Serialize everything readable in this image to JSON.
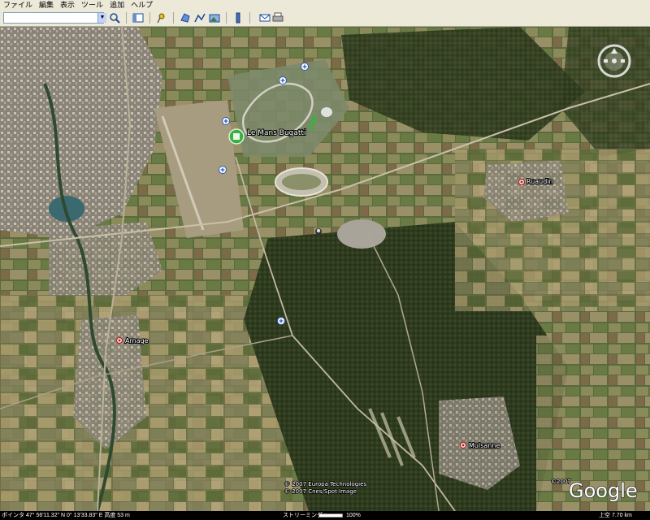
{
  "menu": [
    "ファイル",
    "編集",
    "表示",
    "ツール",
    "追加",
    "ヘルプ"
  ],
  "search": {
    "value": ""
  },
  "map": {
    "poi": {
      "label": "Le Mans Bugatti"
    },
    "places": [
      {
        "label": "Ruaudin"
      },
      {
        "label": "Arnage"
      },
      {
        "label": "Mulsanne"
      }
    ],
    "copyright": [
      "© 2007 Europa Technologies",
      "© 2007 Cnes/Spot Image"
    ],
    "watermark_small": "©2007",
    "logo": "Google"
  },
  "status": {
    "pointer": "ポインタ 47° 56'11.32\" N  0° 13'33.83\" E  高度  53 m",
    "streaming_label": "ストリーミング",
    "streaming_percent": "100%",
    "streaming_progress": 1.0,
    "view": "上空  7.70 km"
  },
  "colors": {
    "ui_bg": "#ece9d8",
    "status_bg": "#000000",
    "place_marker": "#b02020",
    "poi_marker": "#3cb043"
  }
}
